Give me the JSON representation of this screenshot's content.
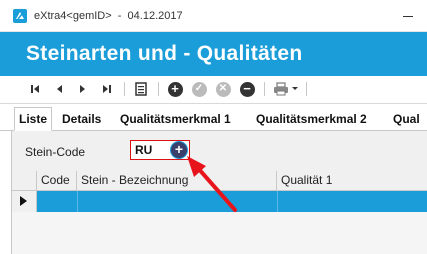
{
  "window": {
    "title": "eXtra4<gemID>  -  04.12.2017"
  },
  "banner": {
    "title": "Steinarten und - Qualitäten"
  },
  "toolbar": {
    "buttons": [
      "first-record-icon",
      "previous-record-icon",
      "next-record-icon",
      "last-record-icon",
      "list-view-icon",
      "add-icon",
      "confirm-icon",
      "cancel-icon",
      "delete-icon",
      "print-icon",
      "dropdown-arrow-icon"
    ]
  },
  "tabs": [
    {
      "label": "Liste",
      "active": true
    },
    {
      "label": "Details",
      "active": false
    },
    {
      "label": "Qualitätsmerkmal 1",
      "active": false
    },
    {
      "label": "Qualitätsmerkmal 2",
      "active": false
    },
    {
      "label": "Qual",
      "active": false
    }
  ],
  "form": {
    "stein_code_label": "Stein-Code",
    "stein_code_value": "RU",
    "add_button": "+"
  },
  "grid": {
    "columns": [
      "Code",
      "Stein - Bezeichnung",
      "Qualität 1"
    ]
  },
  "colors": {
    "accent": "#1b9dd9",
    "highlight_border": "#dd1111",
    "arrow": "#e8141c"
  }
}
